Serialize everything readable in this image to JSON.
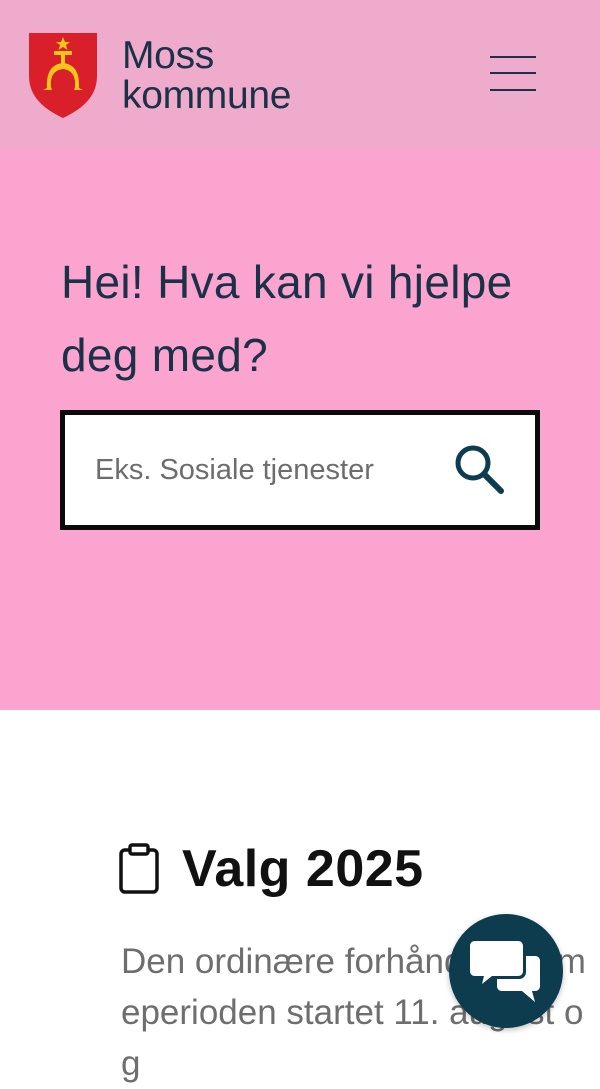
{
  "header": {
    "logo_line1": "Moss",
    "logo_line2": "kommune",
    "menu_icon": "hamburger-menu-icon"
  },
  "hero": {
    "title": "Hei! Hva kan vi hjelpe deg med?",
    "search": {
      "placeholder": "Eks. Sosiale tjenester",
      "value": "",
      "icon": "search-icon"
    }
  },
  "news": {
    "icon": "clipboard-icon",
    "title": "Valg 2025",
    "text": "Den ordinære forhåndsstemmeperioden startet 11. august og"
  },
  "chat": {
    "icon": "chat-bubbles-icon"
  },
  "colors": {
    "header_bg": "#efabcb",
    "hero_bg": "#fba4cf",
    "text_navy": "#1b3147",
    "chat_bg": "#0c3c4e",
    "crest_red": "#d81f2a",
    "crest_gold": "#f5c51c"
  }
}
